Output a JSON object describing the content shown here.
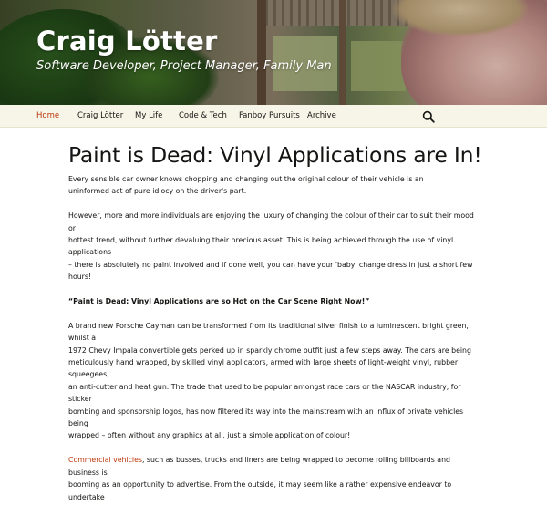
{
  "site": {
    "title": "Craig Lötter",
    "description": "Software Developer, Project Manager, Family Man"
  },
  "nav": {
    "items": [
      {
        "label": "Home",
        "current": true
      },
      {
        "label": "Craig Lötter",
        "current": false
      },
      {
        "label": "My Life",
        "current": false
      },
      {
        "label": "Code & Tech",
        "current": false
      },
      {
        "label": "Fanboy Pursuits",
        "current": false
      },
      {
        "label": "Archive",
        "current": false
      }
    ],
    "search_icon": "search-icon"
  },
  "post": {
    "title": "Paint is Dead: Vinyl Applications are In!",
    "p1_line1": "Every sensible car owner knows chopping and changing out the original colour of their vehicle is an",
    "p1_line2": "uninformed act of pure idiocy on the driver's part.",
    "p2_line1": "However, more and more individuals are enjoying the luxury of changing the colour of their car to suit their mood or",
    "p2_line2": "hottest trend, without further devaluing their precious asset. This is being achieved through the use of vinyl applications",
    "p2_line3": "– there is absolutely no paint involved and if done well, you can have your 'baby' change dress in just a short few hours!",
    "quote": "“Paint is Dead: Vinyl Applications are so Hot on the Car Scene Right Now!”",
    "p3_line1": "A brand new Porsche Cayman can be transformed from its traditional silver finish to a luminescent bright green, whilst a",
    "p3_line2": "1972 Chevy Impala convertible gets perked up in sparkly chrome outfit just a few steps away. The cars are being",
    "p3_line3": "meticulously hand wrapped, by skilled vinyl applicators, armed with large sheets of light-weight vinyl, rubber squeegees,",
    "p3_line4": "an anti-cutter and heat gun. The trade that used to be popular amongst race cars or the NASCAR industry, for sticker",
    "p3_line5": "bombing and sponsorship logos, has now filtered its way into the mainstream with an influx of private vehicles being",
    "p3_line6": "wrapped – often without any graphics at all, just a simple application of colour!",
    "p4_link": "Commercial vehicles",
    "p4_line1_rest": ", such as busses, trucks and liners are being wrapped to become rolling billboards and business is",
    "p4_line2": "booming as an opportunity to advertise. From the outside, it may seem like a rather expensive endeavor to undertake"
  },
  "colors": {
    "accent": "#bc360a",
    "nav_bg": "#f7f5e7",
    "text": "#141412"
  }
}
